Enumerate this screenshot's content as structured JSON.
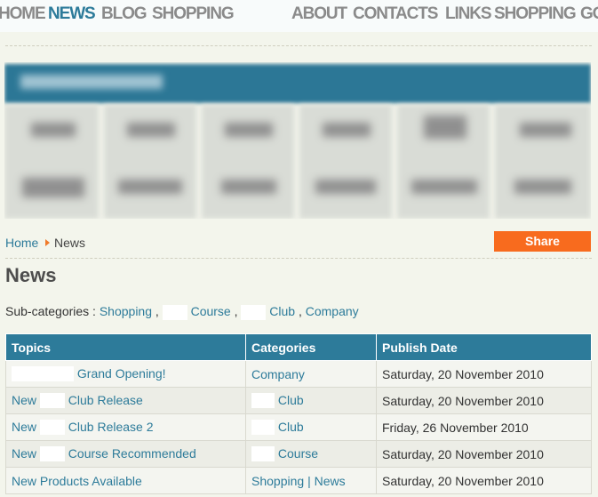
{
  "nav": {
    "items": [
      {
        "label": "HOME",
        "active": false
      },
      {
        "label": "NEWS",
        "active": true
      },
      {
        "label": "BLOG",
        "active": false
      },
      {
        "label": "SHOPPING",
        "active": false
      },
      {
        "label": "ABOUT",
        "active": false
      },
      {
        "label": "CONTACTS",
        "active": false
      },
      {
        "label": "LINKS",
        "active": false
      },
      {
        "label": "SHOPPING",
        "active": false
      },
      {
        "label": "GO",
        "active": false
      }
    ]
  },
  "breadcrumb": {
    "home": "Home",
    "current": "News"
  },
  "share_label": "Share",
  "page_title": "News",
  "subcategories": {
    "label": "Sub-categories :",
    "links": [
      "Shopping",
      "Course",
      "Club",
      "Company"
    ]
  },
  "table": {
    "headers": [
      "Topics",
      "Categories",
      "Publish Date"
    ],
    "rows": [
      {
        "topic_pre": "",
        "topic": "Grand Opening!",
        "category_pre": "",
        "category": "Company",
        "category2": "",
        "date": "Saturday, 20 November 2010"
      },
      {
        "topic_pre": "New",
        "topic": "Club Release",
        "category_pre": "",
        "category": "Club",
        "category2": "",
        "date": "Saturday, 20 November 2010"
      },
      {
        "topic_pre": "New",
        "topic": "Club Release 2",
        "category_pre": "",
        "category": "Club",
        "category2": "",
        "date": "Friday, 26 November 2010"
      },
      {
        "topic_pre": "New",
        "topic": "Course Recommended",
        "category_pre": "",
        "category": "Course",
        "category2": "",
        "date": "Saturday, 20 November 2010"
      },
      {
        "topic_pre": "",
        "topic": "New Products Available",
        "category_pre": "",
        "category": "Shopping",
        "category2": "News",
        "date": "Saturday, 20 November 2010"
      }
    ]
  },
  "colors": {
    "accent": "#2d7b9a",
    "share": "#f86b1e",
    "background": "#f3f5ec"
  }
}
